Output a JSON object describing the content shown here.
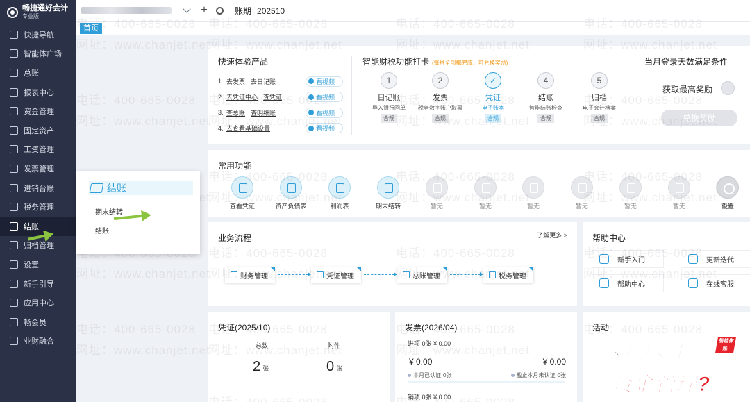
{
  "brand": {
    "name": "畅捷通好会计",
    "edition": "专业版"
  },
  "sidebar": {
    "items": [
      {
        "label": "快捷导航",
        "icon": "home-icon"
      },
      {
        "label": "智能体广场",
        "icon": "ai-icon"
      },
      {
        "label": "总账",
        "icon": "ledger-icon"
      },
      {
        "label": "报表中心",
        "icon": "chart-icon"
      },
      {
        "label": "资金管理",
        "icon": "money-icon"
      },
      {
        "label": "固定资产",
        "icon": "asset-icon"
      },
      {
        "label": "工资管理",
        "icon": "salary-icon"
      },
      {
        "label": "发票管理",
        "icon": "invoice-icon"
      },
      {
        "label": "进销台账",
        "icon": "stock-icon"
      },
      {
        "label": "税务管理",
        "icon": "tax-icon"
      },
      {
        "label": "结账",
        "icon": "closing-icon"
      },
      {
        "label": "归档管理",
        "icon": "archive-icon"
      },
      {
        "label": "设置",
        "icon": "gear-icon"
      },
      {
        "label": "新手引导",
        "icon": "guide-icon"
      },
      {
        "label": "应用中心",
        "icon": "app-icon"
      },
      {
        "label": "畅会员",
        "icon": "vip-icon"
      },
      {
        "label": "业财融合",
        "icon": "fusion-icon"
      }
    ],
    "active_index": 10
  },
  "topbar": {
    "add": "+",
    "period_label": "账期",
    "period_value": "202510"
  },
  "tabs": {
    "home": "首页"
  },
  "quick": {
    "title": "快速体验产品",
    "rows": [
      {
        "num": "1.",
        "links": [
          "去发票",
          "去日记账"
        ],
        "video": "看视频"
      },
      {
        "num": "2.",
        "links": [
          "去凭证中心",
          "查凭证"
        ],
        "video": "看视频"
      },
      {
        "num": "3.",
        "links": [
          "查总账",
          "查明细账"
        ],
        "video": "看视频"
      },
      {
        "num": "4.",
        "links": [
          "去查看基础设置"
        ],
        "video": "看视频"
      }
    ]
  },
  "steps": {
    "title": "智能财税功能打卡",
    "hint": "(每月全部都完成，可兑换奖励)",
    "items": [
      {
        "num": "1",
        "name": "日记账",
        "desc": "导入银行回单",
        "tag": "合规",
        "done": false
      },
      {
        "num": "2",
        "name": "发票",
        "desc": "税务数字账户取票",
        "tag": "合规",
        "done": false
      },
      {
        "num": "✓",
        "name": "凭证",
        "desc": "电子账本",
        "tag": "合规",
        "done": true
      },
      {
        "num": "4",
        "name": "结账",
        "desc": "智能结账检查",
        "tag": "合规",
        "done": false
      },
      {
        "num": "5",
        "name": "归档",
        "desc": "电子会计档案",
        "tag": "合规",
        "done": false
      }
    ]
  },
  "reward": {
    "title": "当月登录天数满足条件",
    "text": "获取最高奖励",
    "button": "兑换奖励"
  },
  "common": {
    "title": "常用功能",
    "items": [
      "查看凭证",
      "资产负债表",
      "利润表",
      "期末结转",
      "暂无",
      "暂无",
      "暂无",
      "暂无",
      "暂无",
      "暂无",
      "暂无",
      "设置"
    ]
  },
  "popup": {
    "title": "结账",
    "items": [
      "期末结转",
      "结账"
    ]
  },
  "flow": {
    "title": "业务流程",
    "more": "了解更多 >",
    "nodes": [
      "财务管理",
      "凭证管理",
      "总账管理",
      "税务管理"
    ]
  },
  "help": {
    "title": "帮助中心",
    "items": [
      "新手入门",
      "更新迭代",
      "帮助中心",
      "在线客服"
    ]
  },
  "voucher": {
    "title": "凭证(2025/10)",
    "total_label": "总数",
    "total": "2",
    "attach_label": "附件",
    "attach": "0",
    "unit": "张"
  },
  "invoice": {
    "title": "发票(2026/04)",
    "in_label": "进项",
    "in_count": "0张",
    "in_amount": "¥ 0.00",
    "big_left": "¥ 0.00",
    "big_right": "¥ 0.00",
    "certified": "本月已认证",
    "certified_count": "0张",
    "uncertified": "截止本月未认证",
    "uncertified_count": "0张",
    "out_label": "销项",
    "out_count": "0张",
    "out_amount": "¥ 0.00"
  },
  "activity": {
    "title": "活动"
  },
  "watermark": {
    "phone": "电话：400-665-0028",
    "site": "网址：www.chanjet.net"
  },
  "promo": {
    "line1": "如何使用",
    "line2": "资金管理?",
    "badge": "智能做账"
  },
  "colors": {
    "accent": "#2f9ed8",
    "sidebar": "#2b3247",
    "arrow": "#8bc53f",
    "promo_red": "#e6222b",
    "hint": "#f29c1f"
  }
}
